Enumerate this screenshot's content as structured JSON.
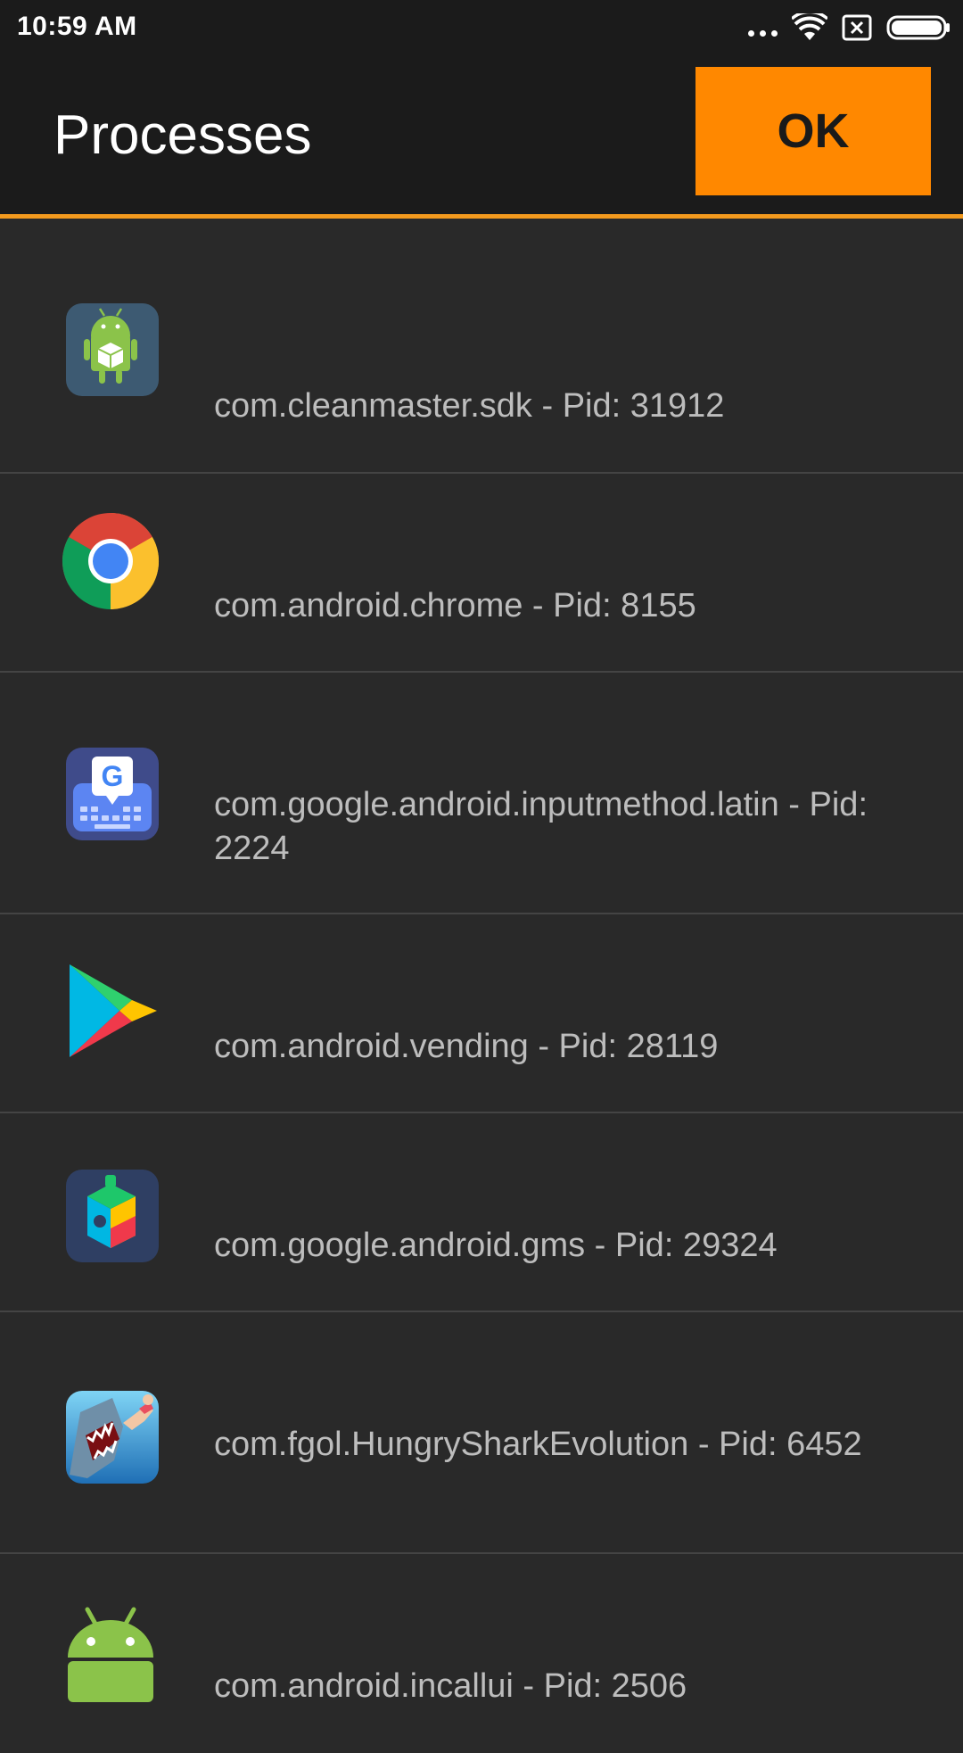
{
  "status_bar": {
    "time": "10:59 AM",
    "icons": [
      "more-dots-icon",
      "wifi-icon",
      "no-sim-icon",
      "battery-icon"
    ]
  },
  "toolbar": {
    "title": "Processes",
    "ok_label": "OK",
    "accent_color": "#ff8800"
  },
  "processes": [
    {
      "icon": "android-package-icon",
      "label": "com.cleanmaster.sdk - Pid: 31912"
    },
    {
      "icon": "chrome-icon",
      "label": "com.android.chrome - Pid: 8155"
    },
    {
      "icon": "gboard-icon",
      "label": "com.google.android.inputmethod.latin - Pid: 2224"
    },
    {
      "icon": "play-store-icon",
      "label": "com.android.vending - Pid: 28119"
    },
    {
      "icon": "play-services-icon",
      "label": "com.google.android.gms - Pid: 29324"
    },
    {
      "icon": "hungry-shark-icon",
      "label": "com.fgol.HungrySharkEvolution - Pid: 6452"
    },
    {
      "icon": "android-icon",
      "label": "com.android.incallui - Pid: 2506"
    }
  ]
}
